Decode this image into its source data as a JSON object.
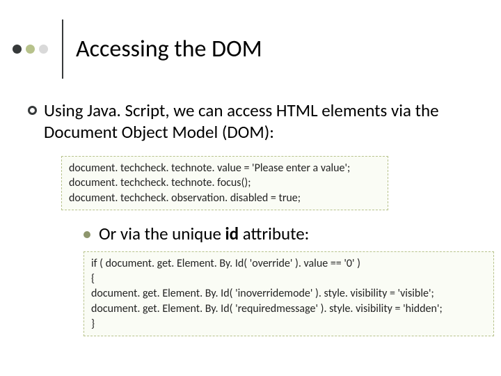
{
  "title": "Accessing the DOM",
  "dots": [
    {
      "fill": "#36393a"
    },
    {
      "fill": "#b7c28b"
    },
    {
      "fill": "#d9d9d9"
    }
  ],
  "point1": "Using Java. Script, we can access HTML elements via the Document Object Model (DOM):",
  "code1": "document. techcheck. technote. value = 'Please enter a value';\ndocument. techcheck. technote. focus();\ndocument. techcheck. observation. disabled = true;",
  "point2_pre": "Or via the unique ",
  "point2_bold": "id",
  "point2_post": " attribute:",
  "code2": "if ( document. get. Element. By. Id( 'override' ). value == '0' )\n{\ndocument. get. Element. By. Id( 'inoverridemode' ). style. visibility = 'visible';\ndocument. get. Element. By. Id( 'requiredmessage' ). style. visibility = 'hidden';\n}"
}
